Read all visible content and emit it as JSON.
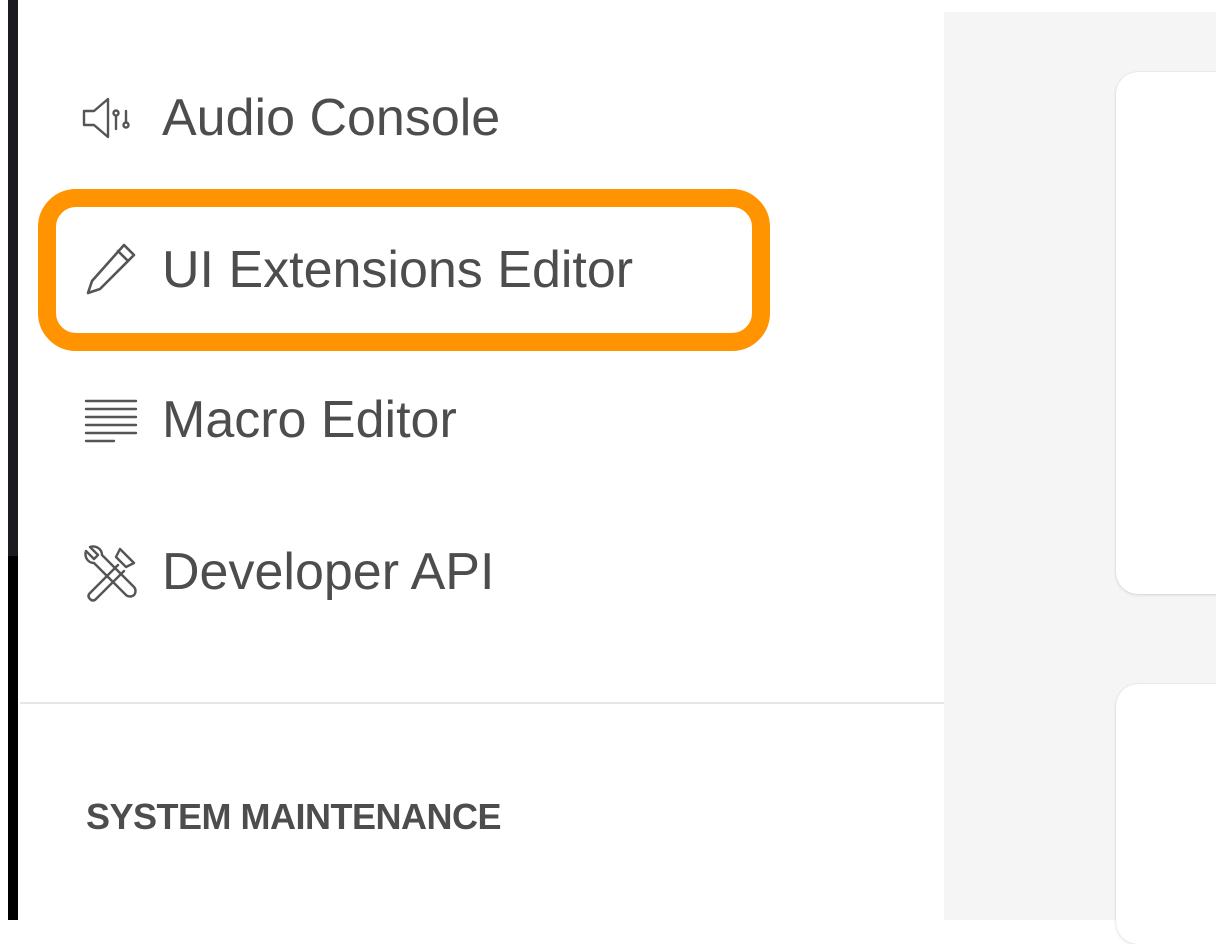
{
  "sidebar": {
    "items": [
      {
        "label": "Audio Console",
        "icon": "speaker-icon"
      },
      {
        "label": "UI Extensions Editor",
        "icon": "pencil-icon",
        "highlighted": true
      },
      {
        "label": "Macro Editor",
        "icon": "lines-icon"
      },
      {
        "label": "Developer API",
        "icon": "tools-icon"
      }
    ],
    "section_heading": "SYSTEM MAINTENANCE"
  },
  "colors": {
    "highlight": "#ff9300",
    "text": "#4d4d4d",
    "content_bg": "#f5f5f5"
  }
}
